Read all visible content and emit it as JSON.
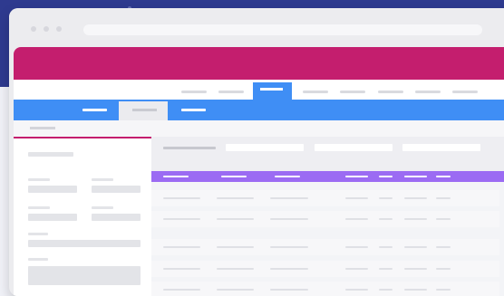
{
  "colors": {
    "background_top": "#2E3A8F",
    "background_bottom": "#F1F2F8",
    "window": "#ECECEF",
    "brand_bar": "#C41E6E",
    "nav_accent": "#3F8EF5",
    "table_header": "#9B6BF3",
    "placeholder_text": "#D9DADF",
    "content": "#FFFFFF"
  },
  "icons": [
    "window-close-dot",
    "window-minimize-dot",
    "window-maximize-dot"
  ],
  "top_nav": {
    "item_count": 8,
    "active_index": 2
  },
  "sub_nav": {
    "tab_count": 3,
    "active_index": 1
  },
  "sidebar": {
    "accent_color": "#C41E6E"
  },
  "table": {
    "row_count": 5
  }
}
